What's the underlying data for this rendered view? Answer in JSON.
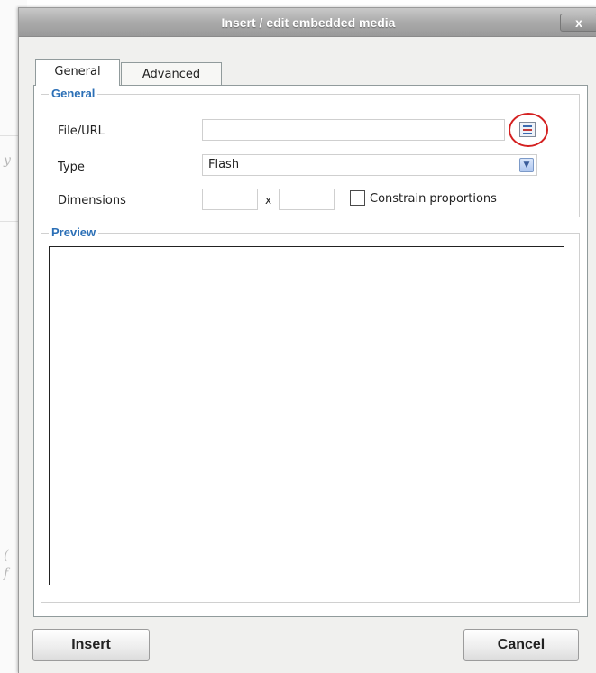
{
  "dialog": {
    "title": "Insert / edit embedded media",
    "close_glyph": "x"
  },
  "tabs": [
    {
      "label": "General",
      "active": true
    },
    {
      "label": "Advanced",
      "active": false
    }
  ],
  "general": {
    "legend": "General",
    "file_url_label": "File/URL",
    "file_url_value": "",
    "browse_icon": "browse-file-icon",
    "type_label": "Type",
    "type_value": "Flash",
    "dimensions_label": "Dimensions",
    "width_value": "",
    "height_value": "",
    "dimension_separator": "x",
    "constrain_label": "Constrain proportions",
    "constrain_checked": false
  },
  "preview": {
    "legend": "Preview"
  },
  "buttons": {
    "insert_label": "Insert",
    "cancel_label": "Cancel"
  },
  "background_page": {
    "glyphs": [
      "y",
      "(",
      "f"
    ]
  },
  "colors": {
    "legend_blue": "#2b6fb6",
    "highlight_red": "#d42020",
    "title_bar_grey": "#aaaaaa"
  }
}
